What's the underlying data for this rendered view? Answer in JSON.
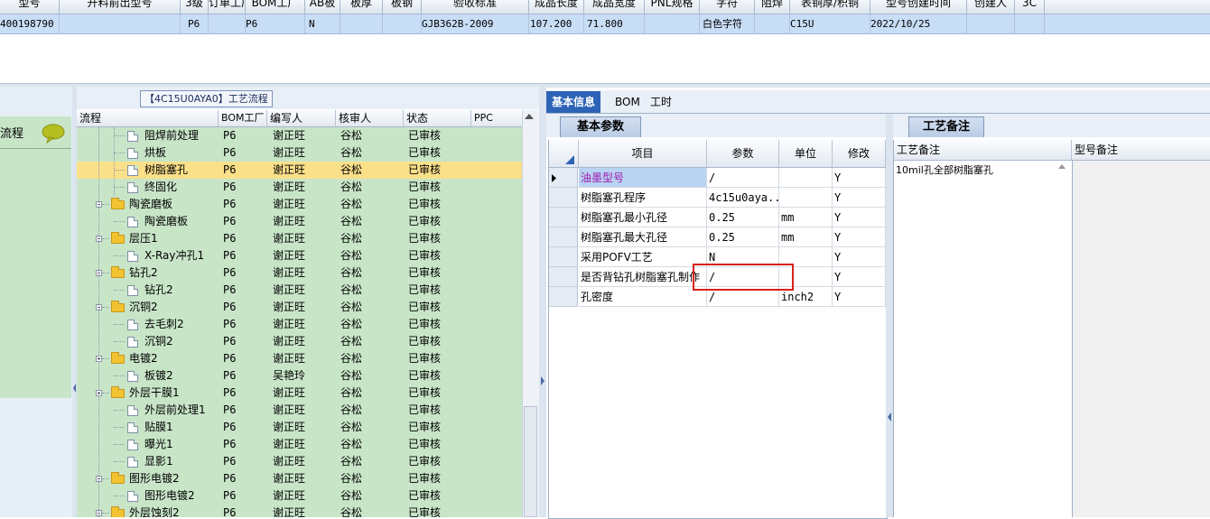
{
  "top_grid": {
    "headers": [
      "型号",
      "开料前出型号",
      "3级",
      "订单工厂",
      "BOM工厂",
      "AB板",
      "板厚",
      "板钢",
      "验收标准",
      "成品长度",
      "成品宽度",
      "PNL规格",
      "字符",
      "阻焊",
      "表铜厚/积铜",
      "型号创建时间",
      "创建人",
      "3C"
    ],
    "row": [
      "400198790",
      "",
      "",
      "P6",
      "P6",
      "N",
      "",
      "",
      "GJB362B-2009",
      "107.200",
      "71.800",
      "",
      "白色字符",
      "",
      "C15U",
      "2022/10/25",
      "",
      ""
    ]
  },
  "left_strip": {
    "item_label": "流程"
  },
  "tree": {
    "title": "【4C15U0AYA0】工艺流程",
    "columns": [
      "流程",
      "BOM工厂",
      "编写人",
      "核审人",
      "状态",
      "PPC"
    ],
    "rows": [
      {
        "name": "阻焊前处理",
        "factory": "P6",
        "author": "谢正旺",
        "reviewer": "谷松",
        "status": "已审核",
        "type": "file"
      },
      {
        "name": "烘板",
        "factory": "P6",
        "author": "谢正旺",
        "reviewer": "谷松",
        "status": "已审核",
        "type": "file"
      },
      {
        "name": "树脂塞孔",
        "factory": "P6",
        "author": "谢正旺",
        "reviewer": "谷松",
        "status": "已审核",
        "type": "file",
        "selected": true
      },
      {
        "name": "终固化",
        "factory": "P6",
        "author": "谢正旺",
        "reviewer": "谷松",
        "status": "已审核",
        "type": "file"
      },
      {
        "name": "陶瓷磨板",
        "factory": "P6",
        "author": "谢正旺",
        "reviewer": "谷松",
        "status": "已审核",
        "type": "folder"
      },
      {
        "name": "陶瓷磨板",
        "factory": "P6",
        "author": "谢正旺",
        "reviewer": "谷松",
        "status": "已审核",
        "type": "file"
      },
      {
        "name": "层压1",
        "factory": "P6",
        "author": "谢正旺",
        "reviewer": "谷松",
        "status": "已审核",
        "type": "folder"
      },
      {
        "name": "X-Ray冲孔1",
        "factory": "P6",
        "author": "谢正旺",
        "reviewer": "谷松",
        "status": "已审核",
        "type": "file"
      },
      {
        "name": "钻孔2",
        "factory": "P6",
        "author": "谢正旺",
        "reviewer": "谷松",
        "status": "已审核",
        "type": "folder"
      },
      {
        "name": "钻孔2",
        "factory": "P6",
        "author": "谢正旺",
        "reviewer": "谷松",
        "status": "已审核",
        "type": "file"
      },
      {
        "name": "沉铜2",
        "factory": "P6",
        "author": "谢正旺",
        "reviewer": "谷松",
        "status": "已审核",
        "type": "folder"
      },
      {
        "name": "去毛刺2",
        "factory": "P6",
        "author": "谢正旺",
        "reviewer": "谷松",
        "status": "已审核",
        "type": "file"
      },
      {
        "name": "沉铜2",
        "factory": "P6",
        "author": "谢正旺",
        "reviewer": "谷松",
        "status": "已审核",
        "type": "file"
      },
      {
        "name": "电镀2",
        "factory": "P6",
        "author": "谢正旺",
        "reviewer": "谷松",
        "status": "已审核",
        "type": "folder"
      },
      {
        "name": "板镀2",
        "factory": "P6",
        "author": "吴艳玲",
        "reviewer": "谷松",
        "status": "已审核",
        "type": "file"
      },
      {
        "name": "外层干膜1",
        "factory": "P6",
        "author": "谢正旺",
        "reviewer": "谷松",
        "status": "已审核",
        "type": "folder"
      },
      {
        "name": "外层前处理1",
        "factory": "P6",
        "author": "谢正旺",
        "reviewer": "谷松",
        "status": "已审核",
        "type": "file"
      },
      {
        "name": "贴膜1",
        "factory": "P6",
        "author": "谢正旺",
        "reviewer": "谷松",
        "status": "已审核",
        "type": "file"
      },
      {
        "name": "曝光1",
        "factory": "P6",
        "author": "谢正旺",
        "reviewer": "谷松",
        "status": "已审核",
        "type": "file"
      },
      {
        "name": "显影1",
        "factory": "P6",
        "author": "谢正旺",
        "reviewer": "谷松",
        "status": "已审核",
        "type": "file"
      },
      {
        "name": "图形电镀2",
        "factory": "P6",
        "author": "谢正旺",
        "reviewer": "谷松",
        "status": "已审核",
        "type": "folder"
      },
      {
        "name": "图形电镀2",
        "factory": "P6",
        "author": "谢正旺",
        "reviewer": "谷松",
        "status": "已审核",
        "type": "file"
      },
      {
        "name": "外层蚀刻2",
        "factory": "P6",
        "author": "谢正旺",
        "reviewer": "谷松",
        "status": "已审核",
        "type": "folder"
      }
    ]
  },
  "tabs": [
    "基本信息",
    "BOM",
    "工时"
  ],
  "params": {
    "tab_label": "基本参数",
    "columns": [
      "项目",
      "参数",
      "单位",
      "修改"
    ],
    "rows": [
      {
        "item": "油墨型号",
        "value": "/",
        "unit": "",
        "edit": "Y",
        "current": true
      },
      {
        "item": "树脂塞孔程序",
        "value": "4c15u0aya...",
        "unit": "",
        "edit": "Y"
      },
      {
        "item": "树脂塞孔最小孔径",
        "value": "0.25",
        "unit": "mm",
        "edit": "Y"
      },
      {
        "item": "树脂塞孔最大孔径",
        "value": "0.25",
        "unit": "mm",
        "edit": "Y"
      },
      {
        "item": "采用POFV工艺",
        "value": "N",
        "unit": "",
        "edit": "Y"
      },
      {
        "item": "是否背钻孔树脂塞孔制作",
        "value": "/",
        "unit": "",
        "edit": "Y"
      },
      {
        "item": "孔密度",
        "value": "/",
        "unit": "inch2",
        "edit": "Y"
      }
    ]
  },
  "remarks": {
    "tab_label": "工艺备注",
    "columns": [
      "工艺备注",
      "型号备注"
    ],
    "process_remark": "10mil孔全部树脂塞孔"
  },
  "colors": {
    "tree_bg": "#c8e5c8",
    "selected_row": "#fbe08a",
    "tab_active": "#2d63b6",
    "highlight": "#d9201c"
  }
}
